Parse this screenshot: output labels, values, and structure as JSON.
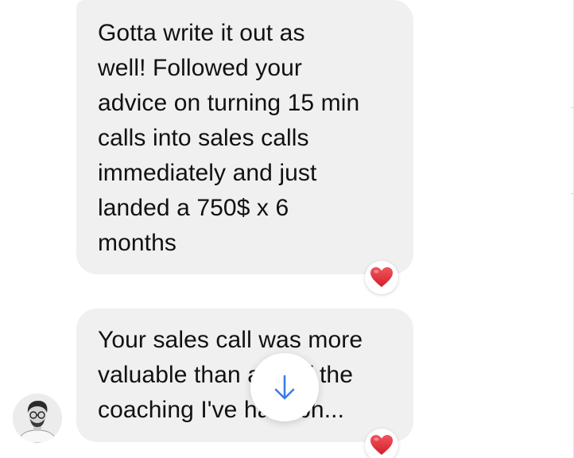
{
  "conversation": {
    "messages": [
      {
        "text": "Gotta write it out as\nwell! Followed your\nadvice on turning 15 min\ncalls into sales calls\nimmediately and just\nlanded a 750$ x 6\nmonths",
        "reaction": "heart-icon"
      },
      {
        "text": "Your sales call was more\nvaluable than any of the\ncoaching I've had tbh...",
        "reaction": "heart-icon"
      }
    ]
  },
  "controls": {
    "scroll_to_bottom_icon": "arrow-down-icon"
  },
  "colors": {
    "bubble_background": "#f0f0f0",
    "text": "#111111",
    "heart": "#e0323c",
    "scroll_arrow": "#3a7ee8"
  }
}
